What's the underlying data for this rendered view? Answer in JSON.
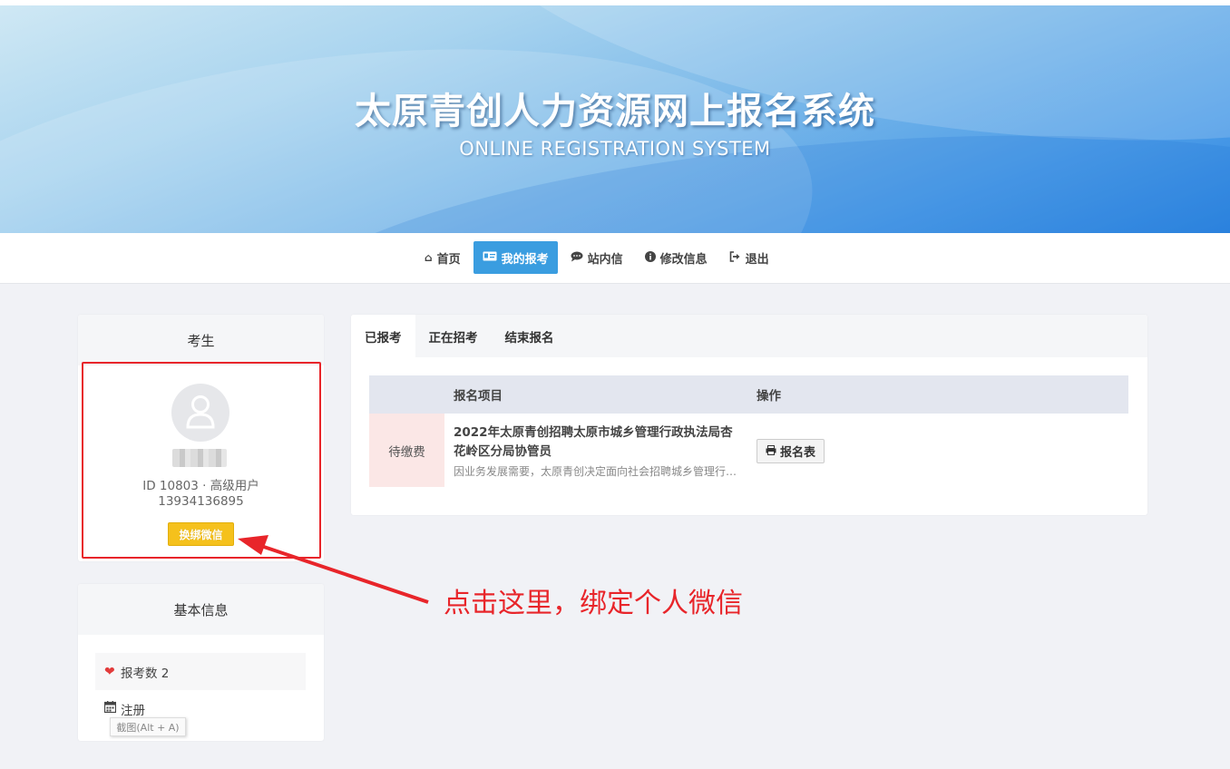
{
  "banner": {
    "title": "太原青创人力资源网上报名系统",
    "subtitle": "ONLINE REGISTRATION SYSTEM"
  },
  "nav": {
    "items": [
      {
        "label": "首页",
        "icon": "home-icon"
      },
      {
        "label": "我的报考",
        "icon": "id-card-icon",
        "active": true
      },
      {
        "label": "站内信",
        "icon": "comment-icon"
      },
      {
        "label": "修改信息",
        "icon": "info-icon"
      },
      {
        "label": "退出",
        "icon": "sign-out-icon"
      }
    ]
  },
  "profile": {
    "heading": "考生",
    "id_line": "ID 10803 · 高级用户",
    "phone": "13934136895",
    "wechat_button": "换绑微信"
  },
  "basic_info": {
    "heading": "基本信息",
    "rows": [
      {
        "icon": "heart-icon",
        "label": "报考数 2"
      },
      {
        "icon": "calendar-icon",
        "label": "注册"
      }
    ],
    "tooltip": "截图(Alt + A)"
  },
  "main": {
    "tabs": [
      {
        "label": "已报考",
        "active": true
      },
      {
        "label": "正在招考"
      },
      {
        "label": "结束报名"
      }
    ],
    "table": {
      "headers": [
        "报名项目",
        "操作"
      ],
      "rows": [
        {
          "status": "待缴费",
          "title": "2022年太原青创招聘太原市城乡管理行政执法局杏花岭区分局协管员",
          "description": "因业务发展需要，太原青创决定面向社会招聘城乡管理行政执法局杏花岭区分局协管员",
          "action": "报名表"
        }
      ]
    }
  },
  "annotation": {
    "text": "点击这里，绑定个人微信",
    "color": "#e8252a"
  }
}
